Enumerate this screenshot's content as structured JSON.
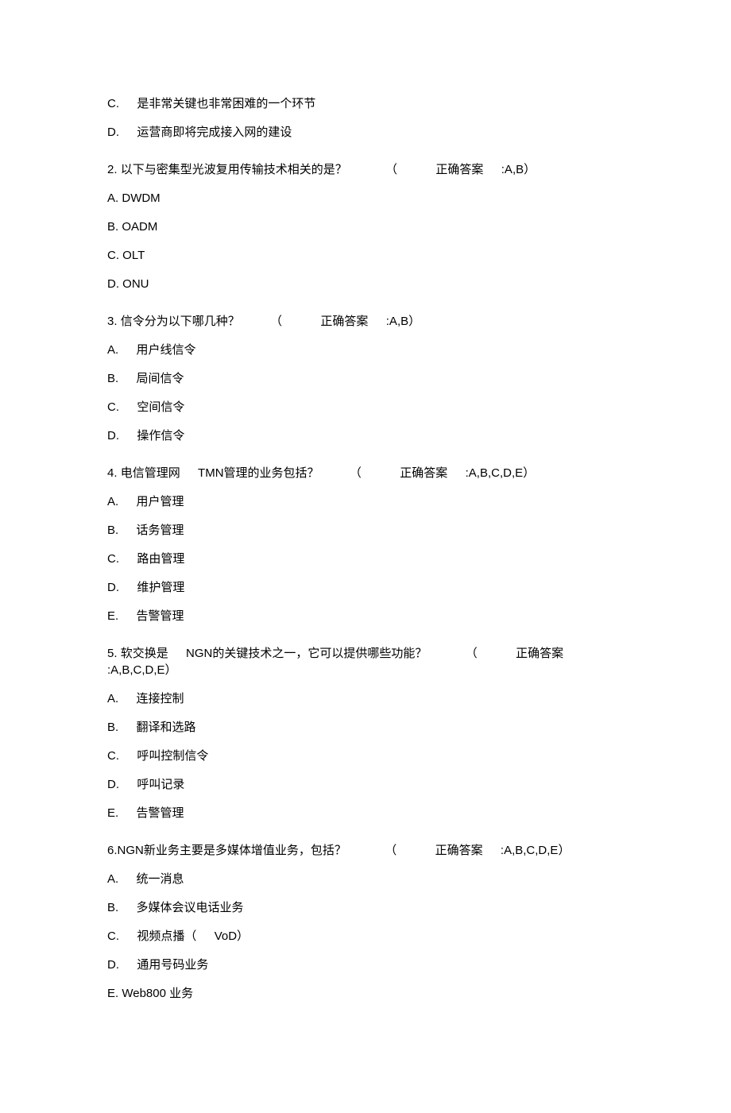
{
  "orphan_options": {
    "c": {
      "prefix": "C. ",
      "text": "是非常关键也非常困难的一个环节"
    },
    "d": {
      "prefix": "D. ",
      "text": "运营商即将完成接入网的建设"
    }
  },
  "q2": {
    "number": "2.",
    "stem": "以下与密集型光波复用传输技术相关的是？",
    "paren_open": "（",
    "ans_label": "正确答案",
    "ans_value": ":A,B）",
    "opts": {
      "a": {
        "prefix": "A. ",
        "text": "DWDM"
      },
      "b": {
        "prefix": "B. ",
        "text": "OADM"
      },
      "c": {
        "prefix": "C. ",
        "text": "OLT"
      },
      "d": {
        "prefix": "D. ",
        "text": "ONU"
      }
    }
  },
  "q3": {
    "number": "3.",
    "stem": "信令分为以下哪几种？",
    "paren_open": "（",
    "ans_label": "正确答案",
    "ans_value": ":A,B）",
    "opts": {
      "a": {
        "prefix": "A. ",
        "text": "用户线信令"
      },
      "b": {
        "prefix": "B. ",
        "text": "局间信令"
      },
      "c": {
        "prefix": "C. ",
        "text": "空间信令"
      },
      "d": {
        "prefix": "D. ",
        "text": "操作信令"
      }
    }
  },
  "q4": {
    "number": "4.",
    "stem_a": "电信管理网",
    "stem_b": "TMN管理的业务包括？",
    "paren_open": "（",
    "ans_label": "正确答案",
    "ans_value": ":A,B,C,D,E）",
    "opts": {
      "a": {
        "prefix": "A. ",
        "text": "用户管理"
      },
      "b": {
        "prefix": "B. ",
        "text": "话务管理"
      },
      "c": {
        "prefix": "C. ",
        "text": "路由管理"
      },
      "d": {
        "prefix": "D. ",
        "text": "维护管理"
      },
      "e": {
        "prefix": "E. ",
        "text": "告警管理"
      }
    }
  },
  "q5": {
    "number": "5.",
    "stem_a": "软交换是",
    "stem_b": "NGN的关键技术之一，它可以提供哪些功能？",
    "paren_open": "（",
    "ans_label": "正确答案",
    "ans_value": ":A,B,C,D,E）",
    "opts": {
      "a": {
        "prefix": "A. ",
        "text": "连接控制"
      },
      "b": {
        "prefix": "B. ",
        "text": "翻译和选路"
      },
      "c": {
        "prefix": "C. ",
        "text": "呼叫控制信令"
      },
      "d": {
        "prefix": "D. ",
        "text": "呼叫记录"
      },
      "e": {
        "prefix": "E. ",
        "text": "告警管理"
      }
    }
  },
  "q6": {
    "number": "6.",
    "stem": "NGN新业务主要是多媒体增值业务，包括？",
    "paren_open": "（",
    "ans_label": "正确答案",
    "ans_value": ":A,B,C,D,E）",
    "opts": {
      "a": {
        "prefix": "A. ",
        "text": "统一消息"
      },
      "b": {
        "prefix": "B. ",
        "text": "多媒体会议电话业务"
      },
      "c": {
        "prefix": "C. ",
        "text_a": "视频点播（",
        "text_b": "VoD）"
      },
      "d": {
        "prefix": "D. ",
        "text": "通用号码业务"
      },
      "e": {
        "prefix": "E. ",
        "text": "Web800 业务"
      }
    }
  }
}
